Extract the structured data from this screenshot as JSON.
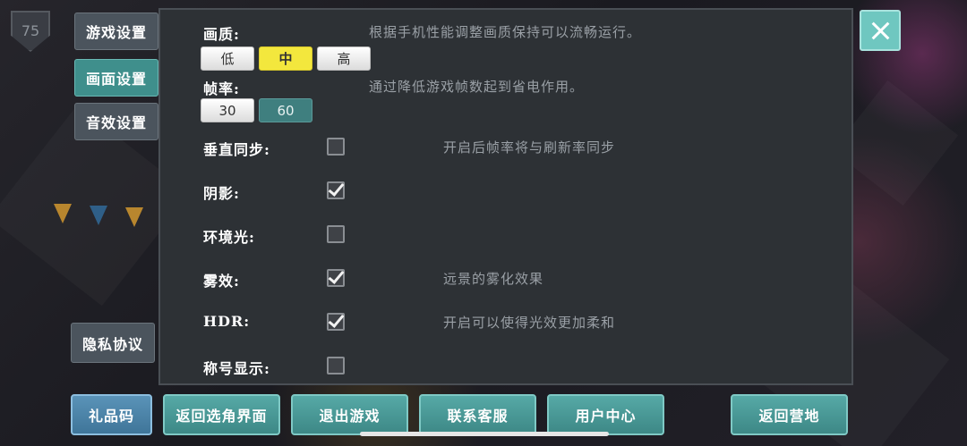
{
  "hud": {
    "level": "75"
  },
  "side_tabs": [
    {
      "label": "游戏设置",
      "active": false
    },
    {
      "label": "画面设置",
      "active": true
    },
    {
      "label": "音效设置",
      "active": false
    }
  ],
  "privacy_label": "隐私协议",
  "settings": {
    "quality": {
      "label": "画质:",
      "desc": "根据手机性能调整画质保持可以流畅运行。",
      "options": [
        "低",
        "中",
        "高"
      ],
      "selected": "中"
    },
    "framerate": {
      "label": "帧率:",
      "desc": "通过降低游戏帧数起到省电作用。",
      "options": [
        "30",
        "60"
      ],
      "selected": "60"
    },
    "toggles": [
      {
        "label": "垂直同步:",
        "checked": false,
        "desc": "开启后帧率将与刷新率同步"
      },
      {
        "label": "阴影:",
        "checked": true,
        "desc": ""
      },
      {
        "label": "环境光:",
        "checked": false,
        "desc": ""
      },
      {
        "label": "雾效:",
        "checked": true,
        "desc": "远景的雾化效果"
      },
      {
        "label": "HDR:",
        "checked": true,
        "desc": "开启可以使得光效更加柔和"
      },
      {
        "label": "称号显示:",
        "checked": false,
        "desc": ""
      }
    ]
  },
  "bottom_buttons": {
    "gift_code": "礼品码",
    "back_to_select": "返回选角界面",
    "exit_game": "退出游戏",
    "contact_support": "联系客服",
    "user_center": "用户中心",
    "back_to_camp": "返回营地"
  },
  "colors": {
    "accent_teal": "#3f8f8c",
    "selected_yellow": "#f3e73d",
    "panel_bg": "#2d3135",
    "close_bg": "#6fc7c0"
  },
  "icons": {
    "close": "close-icon",
    "checkbox_mark": "checkmark-icon"
  }
}
